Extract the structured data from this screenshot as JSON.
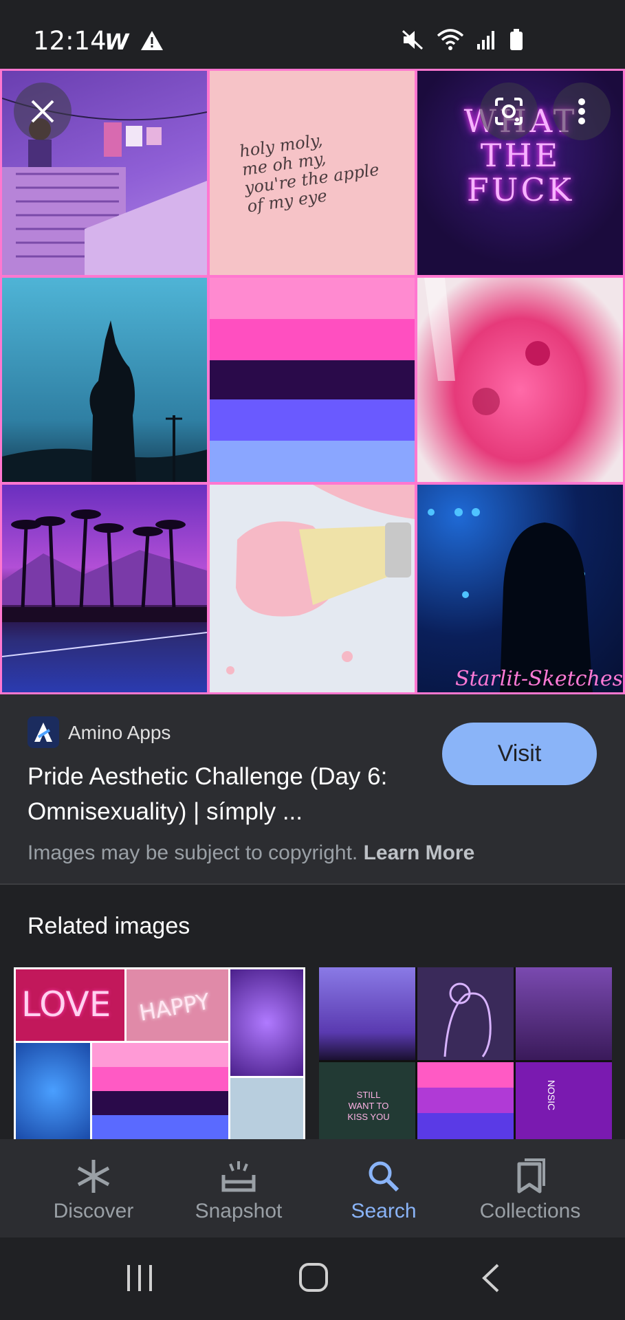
{
  "status_bar": {
    "time": "12:14",
    "left_icons": [
      "w-app-icon",
      "warning-icon"
    ],
    "right_icons": [
      "mute-icon",
      "wifi-icon",
      "signal-icon",
      "battery-icon"
    ]
  },
  "image_viewer": {
    "tiles": {
      "note_text": "holy moly,\nme oh my,\nyou're the apple\nof my eye",
      "neon_sign_text": "WHAT THE FUCK",
      "watermark": "Starlit-Sketches"
    },
    "close_icon": "close-icon",
    "lens_icon": "lens-icon",
    "more_icon": "more-vert-icon"
  },
  "result": {
    "source_name": "Amino Apps",
    "title": "Pride Aesthetic Challenge (Day 6: Omnisexuality) | símply ...",
    "visit_label": "Visit",
    "copyright_text": "Images may be subject to copyright.",
    "learn_more": "Learn More"
  },
  "related": {
    "heading": "Related images",
    "thumb1_text": {
      "love": "LOVE",
      "happy": "HAPPY"
    },
    "thumb2_text": {
      "still": "STILL WANT TO KISS YOU",
      "bottle": "NOSIC"
    }
  },
  "bottom_nav": {
    "items": [
      {
        "label": "Discover",
        "icon": "asterisk-icon"
      },
      {
        "label": "Snapshot",
        "icon": "snapshot-icon"
      },
      {
        "label": "Search",
        "icon": "search-icon",
        "active": true
      },
      {
        "label": "Collections",
        "icon": "collections-icon"
      }
    ]
  },
  "colors": {
    "accent": "#8ab4f8",
    "background": "#202124",
    "panel": "#2c2d31"
  }
}
